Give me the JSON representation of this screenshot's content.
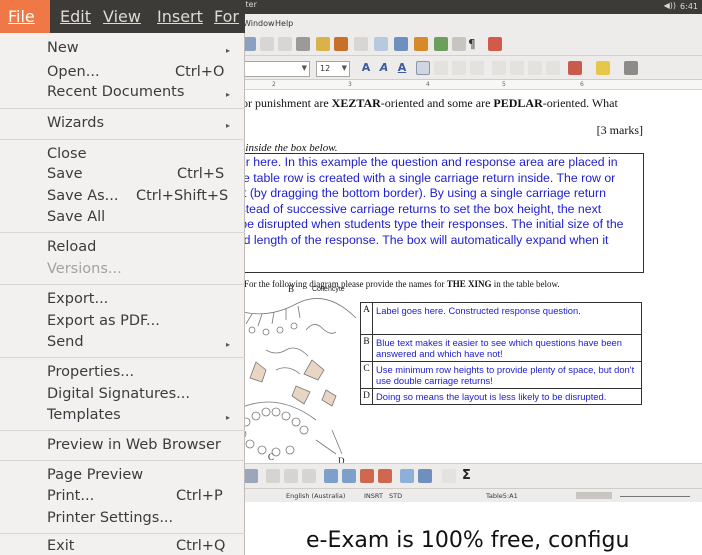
{
  "window": {
    "title_fragment": "riter",
    "clock": "6:41",
    "audio": "◀))"
  },
  "menubar": {
    "items": [
      {
        "label": "File"
      },
      {
        "label": "Edit"
      },
      {
        "label": "View"
      },
      {
        "label": "Insert"
      },
      {
        "label": "For"
      }
    ],
    "secondary": [
      "Window",
      "Help"
    ]
  },
  "toolbar": {
    "font_size": "12"
  },
  "ruler": {
    "marks": [
      "2",
      "3",
      "4",
      "5",
      "6"
    ]
  },
  "file_menu": {
    "items": [
      {
        "label": "New",
        "shortcut": "",
        "submenu": true,
        "enabled": true
      },
      {
        "label": "Open...",
        "shortcut": "Ctrl+O",
        "submenu": false,
        "enabled": true
      },
      {
        "label": "Recent Documents",
        "shortcut": "",
        "submenu": true,
        "enabled": true
      },
      {
        "label": "Wizards",
        "shortcut": "",
        "submenu": true,
        "enabled": true
      },
      {
        "label": "Close",
        "shortcut": "",
        "submenu": false,
        "enabled": true
      },
      {
        "label": "Save",
        "shortcut": "Ctrl+S",
        "submenu": false,
        "enabled": true
      },
      {
        "label": "Save As...",
        "shortcut": "Ctrl+Shift+S",
        "submenu": false,
        "enabled": true
      },
      {
        "label": "Save All",
        "shortcut": "",
        "submenu": false,
        "enabled": true
      },
      {
        "label": "Reload",
        "shortcut": "",
        "submenu": false,
        "enabled": true
      },
      {
        "label": "Versions...",
        "shortcut": "",
        "submenu": false,
        "enabled": false
      },
      {
        "label": "Export...",
        "shortcut": "",
        "submenu": false,
        "enabled": true
      },
      {
        "label": "Export as PDF...",
        "shortcut": "",
        "submenu": false,
        "enabled": true
      },
      {
        "label": "Send",
        "shortcut": "",
        "submenu": true,
        "enabled": true
      },
      {
        "label": "Properties...",
        "shortcut": "",
        "submenu": false,
        "enabled": true
      },
      {
        "label": "Digital Signatures...",
        "shortcut": "",
        "submenu": false,
        "enabled": true
      },
      {
        "label": "Templates",
        "shortcut": "",
        "submenu": true,
        "enabled": true
      },
      {
        "label": "Preview in Web Browser",
        "shortcut": "",
        "submenu": false,
        "enabled": true
      },
      {
        "label": "Page Preview",
        "shortcut": "",
        "submenu": false,
        "enabled": true
      },
      {
        "label": "Print...",
        "shortcut": "Ctrl+P",
        "submenu": false,
        "enabled": true
      },
      {
        "label": "Printer Settings...",
        "shortcut": "",
        "submenu": false,
        "enabled": true
      },
      {
        "label": "Exit",
        "shortcut": "Ctrl+Q",
        "submenu": false,
        "enabled": true
      }
    ]
  },
  "document": {
    "question_pre": "or punishment are ",
    "term1": "XEZTAR",
    "question_mid": "-oriented and some are ",
    "term2": "PEDLAR",
    "question_post": "-oriented. What",
    "marks": "[3 marks]",
    "instruction": "nse inside the box below.",
    "response_lines": [
      "wer here. In this example the question and response area are placed in",
      "nse table row is created with a single carriage return inside. The row or",
      "set (by dragging the bottom border). By using a single carriage return",
      " instead of successive carriage returns to set the box height, the next",
      "o be disrupted when students type their responses. The initial size of the",
      "ired length of the response. The box will automatically expand when it"
    ],
    "question2_pre": "For the following diagram please provide the names for ",
    "question2_term": "THE XING",
    "question2_post": " in the table below.",
    "diagram_labels": {
      "b": "B",
      "collencyte": "Collencyte",
      "c": "C",
      "d": "D"
    },
    "table": [
      {
        "key": "A",
        "text": "Label goes here. Constructed response question."
      },
      {
        "key": "B",
        "text": "Blue text makes it easier to see which questions have been answered and which have not!"
      },
      {
        "key": "C",
        "text": "Use minimum row heights to provide plenty of space, but don't use double carriage returns!"
      },
      {
        "key": "D",
        "text": "Doing so means the layout is less likely to be disrupted."
      }
    ]
  },
  "statusbar": {
    "language": "English (Australia)",
    "insert": "INSRT",
    "std": "STD",
    "cell": "Table5:A1"
  },
  "caption": "e-Exam is 100% free, configu",
  "colors": {
    "accent": "#f07746",
    "menu_bg": "#f2f1f0",
    "response_text": "#2020d0"
  }
}
